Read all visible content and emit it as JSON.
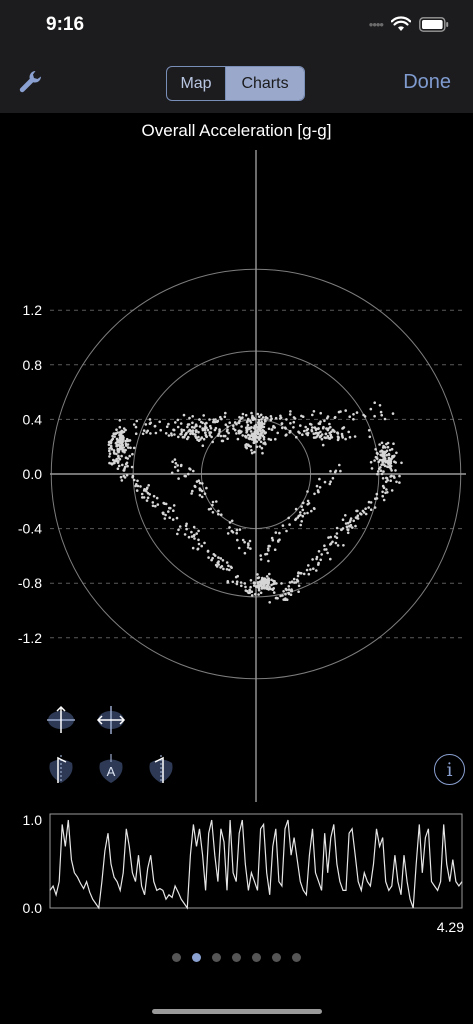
{
  "status": {
    "time": "9:16",
    "signal_dots": "••••"
  },
  "nav": {
    "segments": [
      {
        "label": "Map",
        "selected": false
      },
      {
        "label": "Charts",
        "selected": true
      }
    ],
    "done_label": "Done",
    "accent_color": "#7f9bd0"
  },
  "chart_data": [
    {
      "type": "scatter",
      "title": "Overall Acceleration [g-g]",
      "ylabel": "",
      "xlabel": "",
      "ylim": [
        -1.2,
        1.2
      ],
      "yticks": [
        "1.2",
        "0.8",
        "0.4",
        "0.0",
        "-0.4",
        "-0.8",
        "-1.2"
      ],
      "grid": "dashed horizontal",
      "rings_g": [
        0.4,
        0.9,
        1.5
      ],
      "clusters": [
        {
          "cx": -1.0,
          "cy": 0.2,
          "sx": 0.07,
          "sy": 0.1,
          "n": 120
        },
        {
          "cx": 0.0,
          "cy": 0.3,
          "sx": 0.1,
          "sy": 0.1,
          "n": 150
        },
        {
          "cx": 0.95,
          "cy": 0.1,
          "sx": 0.07,
          "sy": 0.1,
          "n": 100
        },
        {
          "cx": 0.05,
          "cy": -0.8,
          "sx": 0.07,
          "sy": 0.06,
          "n": 90
        },
        {
          "cx": -0.4,
          "cy": 0.3,
          "sx": 0.25,
          "sy": 0.06,
          "n": 90
        },
        {
          "cx": 0.5,
          "cy": 0.3,
          "sx": 0.25,
          "sy": 0.06,
          "n": 90
        }
      ],
      "edges": [
        {
          "from": [
            -1.05,
            0.1
          ],
          "to": [
            0.0,
            -0.9
          ],
          "n": 130
        },
        {
          "from": [
            1.05,
            0.0
          ],
          "to": [
            0.15,
            -0.95
          ],
          "n": 130
        },
        {
          "from": [
            -1.0,
            0.35
          ],
          "to": [
            1.0,
            0.45
          ],
          "n": 120
        },
        {
          "from": [
            -0.6,
            0.1
          ],
          "to": [
            -0.05,
            -0.55
          ],
          "n": 60
        },
        {
          "from": [
            0.6,
            0.05
          ],
          "to": [
            0.05,
            -0.6
          ],
          "n": 60
        }
      ]
    },
    {
      "type": "line",
      "title": "",
      "ylim": [
        0.0,
        1.0
      ],
      "yticks": [
        "1.0",
        "0.0"
      ],
      "x_end_label": "4.29",
      "values": [
        0.2,
        0.25,
        0.15,
        0.3,
        0.95,
        0.7,
        1.0,
        0.55,
        0.4,
        0.35,
        0.28,
        0.22,
        0.3,
        0.18,
        0.1,
        0.05,
        0.0,
        0.3,
        0.65,
        0.85,
        0.5,
        0.35,
        0.3,
        0.2,
        0.4,
        0.9,
        0.7,
        0.4,
        0.3,
        0.6,
        0.25,
        0.15,
        0.45,
        0.6,
        0.3,
        0.2,
        0.22,
        0.2,
        0.1,
        0.15,
        0.12,
        0.25,
        0.18,
        0.1,
        0.05,
        0.0,
        0.6,
        0.95,
        0.7,
        0.9,
        0.6,
        0.2,
        0.85,
        1.0,
        0.6,
        0.3,
        0.9,
        0.75,
        0.2,
        1.0,
        0.4,
        0.3,
        0.85,
        1.0,
        0.5,
        0.2,
        0.4,
        0.3,
        0.2,
        0.9,
        0.95,
        0.4,
        0.15,
        0.7,
        0.9,
        0.3,
        0.25,
        0.9,
        1.0,
        0.6,
        0.8,
        0.55,
        0.3,
        0.2,
        0.15,
        0.6,
        0.9,
        0.4,
        0.3,
        0.2,
        0.85,
        0.4,
        0.8,
        0.95,
        0.5,
        0.3,
        0.2,
        0.2,
        0.85,
        0.9,
        0.6,
        0.3,
        0.2,
        0.4,
        0.3,
        0.25,
        0.5,
        0.9,
        0.7,
        0.8,
        0.3,
        0.2,
        0.25,
        0.6,
        0.3,
        0.15,
        0.6,
        0.3,
        0.1,
        0.0,
        0.5,
        0.95,
        0.4,
        0.8,
        0.9,
        0.3,
        0.25,
        0.2,
        0.3,
        0.95,
        0.5,
        0.3,
        0.55,
        0.3,
        0.25,
        0.3
      ]
    }
  ],
  "controls": {
    "info_glyph": "i",
    "center_icon_letter": "A"
  },
  "pager": {
    "count": 7,
    "active": 1
  }
}
